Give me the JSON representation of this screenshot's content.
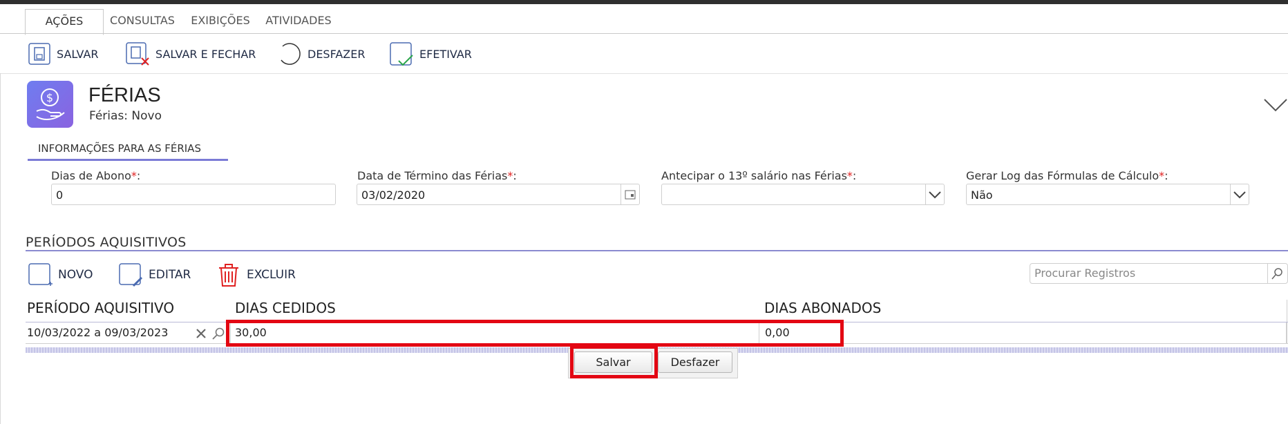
{
  "tabs": [
    "AÇÕES",
    "CONSULTAS",
    "EXIBIÇÕES",
    "ATIVIDADES"
  ],
  "toolbar": {
    "save": "SALVAR",
    "save_close": "SALVAR E FECHAR",
    "undo": "DESFAZER",
    "commit": "EFETIVAR"
  },
  "header": {
    "title": "FÉRIAS",
    "subtitle": "Férias: Novo"
  },
  "section_tab": "INFORMAÇÕES PARA AS FÉRIAS",
  "fields": {
    "dias_abono": {
      "label": "Dias de Abono",
      "value": "0"
    },
    "data_termino": {
      "label": "Data de Término das Férias",
      "value": "03/02/2020"
    },
    "antecipar_13": {
      "label": "Antecipar o 13º salário nas Férias",
      "value": ""
    },
    "gerar_log": {
      "label": "Gerar Log das Fórmulas de Cálculo",
      "value": "Não"
    }
  },
  "required_mark": "*",
  "colon": ":",
  "periods": {
    "title": "PERÍODOS AQUISITIVOS",
    "new": "NOVO",
    "edit": "EDITAR",
    "delete": "EXCLUIR",
    "search_placeholder": "Procurar Registros",
    "columns": [
      "PERÍODO AQUISITIVO",
      "DIAS CEDIDOS",
      "DIAS ABONADOS"
    ],
    "row": {
      "periodo": "10/03/2022 a 09/03/2023",
      "dias_cedidos": "30,00",
      "dias_abonados": "0,00"
    }
  },
  "row_editor": {
    "save": "Salvar",
    "undo": "Desfazer"
  },
  "colors": {
    "accent": "#7b7bd6",
    "highlight": "#e30613",
    "icon_gradient_start": "#6f7df0",
    "icon_gradient_end": "#8a63e0"
  }
}
